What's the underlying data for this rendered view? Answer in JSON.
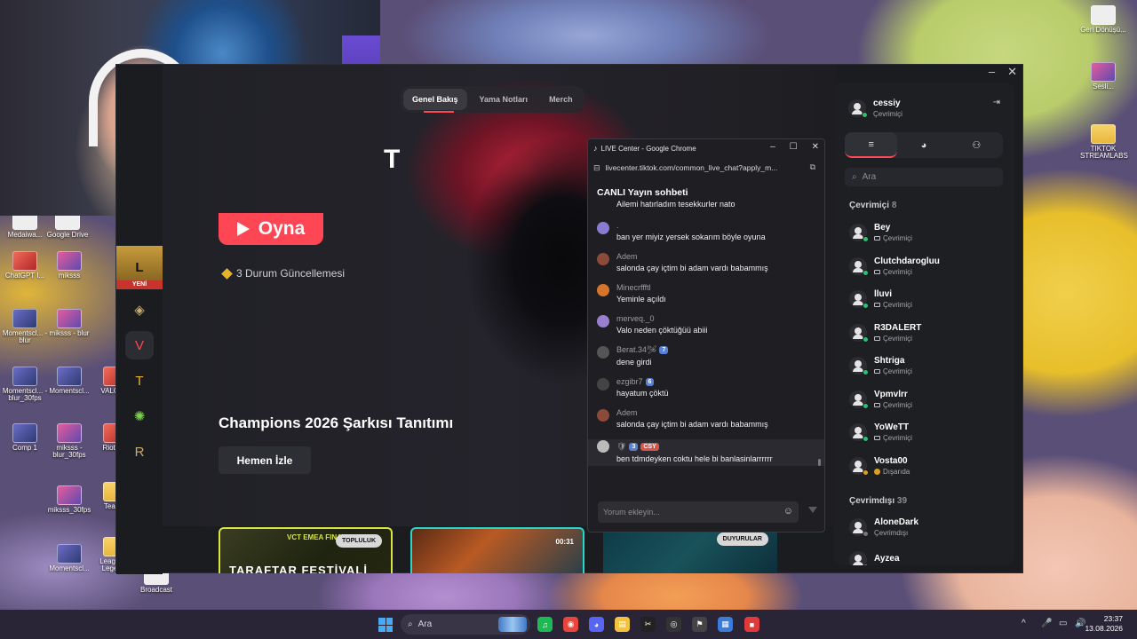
{
  "desktop": {
    "left_icons": [
      {
        "label": "Medaiwa...",
        "kind": "doc"
      },
      {
        "label": "Google Drive",
        "kind": "doc"
      },
      {
        "label": "ChatGPT I...",
        "kind": "red"
      },
      {
        "label": "miksss",
        "kind": "bright"
      },
      {
        "label": "Momentscl... - blur",
        "kind": "video"
      },
      {
        "label": "miksss - blur",
        "kind": "bright"
      },
      {
        "label": "Momentscl... - blur_30fps",
        "kind": "video"
      },
      {
        "label": "Momentscl...",
        "kind": "video"
      },
      {
        "label": "Comp 1",
        "kind": "video"
      },
      {
        "label": "miksss - blur_30fps",
        "kind": "bright"
      },
      {
        "label": "miksss_30fps",
        "kind": "bright"
      },
      {
        "label": "Momentscl...",
        "kind": "video"
      },
      {
        "label": "VALOR...",
        "kind": "red"
      },
      {
        "label": "Riot C...",
        "kind": "red"
      },
      {
        "label": "Team...",
        "kind": "folder"
      },
      {
        "label": "League of Legends",
        "kind": "folder"
      },
      {
        "label": "Broadcast",
        "kind": "doc"
      }
    ],
    "right_icons": [
      {
        "label": "Geri Dönüşü...",
        "kind": "doc"
      },
      {
        "label": "Sesli...",
        "kind": "bright"
      },
      {
        "label": "TIKTOK STREAMLABS",
        "kind": "folder"
      }
    ]
  },
  "riot_client": {
    "window_controls": {
      "minimize": "–",
      "close": "✕"
    },
    "nav_tabs": [
      {
        "label": "Genel Bakış",
        "active": true
      },
      {
        "label": "Yama Notları",
        "active": false
      },
      {
        "label": "Merch",
        "active": false
      }
    ],
    "logo_letter": "T",
    "sidebar": {
      "new_label": "YENİ",
      "items": [
        {
          "name": "league-of-legends",
          "glyph": "L"
        },
        {
          "name": "legends-of-runeterra",
          "glyph": "◈"
        },
        {
          "name": "valorant",
          "glyph": "V"
        },
        {
          "name": "teamfight-tactics",
          "glyph": "T"
        },
        {
          "name": "wild-rift",
          "glyph": "✺"
        },
        {
          "name": "runeterra-2xko",
          "glyph": "R"
        }
      ]
    },
    "play_label": "Oyna",
    "status_updates": "3 Durum Güncellemesi",
    "promo_title": "Champions 2026 Şarkısı Tanıtımı",
    "watch_label": "Hemen İzle",
    "cards": [
      {
        "tag": "TOPLULUK",
        "title": "TARAFTAR FESTİVALİ",
        "logo": "VCT EMEA FINALS",
        "duration": ""
      },
      {
        "tag": "",
        "title": "",
        "logo": "",
        "duration": "00:31"
      },
      {
        "tag": "DUYURULAR",
        "title": "",
        "logo": "",
        "duration": ""
      }
    ]
  },
  "friends": {
    "self": {
      "name": "cessiy",
      "status": "Çevrimiçi"
    },
    "collapse_icon": "⇥",
    "tabs": [
      "≡",
      "◕",
      "⚇"
    ],
    "search_placeholder": "Ara",
    "online_label": "Çevrimiçi",
    "online_count": "8",
    "online": [
      {
        "name": "Bey",
        "status": "Çevrimiçi",
        "state": "online"
      },
      {
        "name": "Clutchdarogluu",
        "status": "Çevrimiçi",
        "state": "online"
      },
      {
        "name": "lluvi",
        "status": "Çevrimiçi",
        "state": "online"
      },
      {
        "name": "R3DALERT",
        "status": "Çevrimiçi",
        "state": "online"
      },
      {
        "name": "Shtriga",
        "status": "Çevrimiçi",
        "state": "online"
      },
      {
        "name": "Vpmvlrr",
        "status": "Çevrimiçi",
        "state": "online"
      },
      {
        "name": "YoWeTT",
        "status": "Çevrimiçi",
        "state": "online"
      },
      {
        "name": "Vosta00",
        "status": "Dışarıda",
        "state": "away"
      }
    ],
    "offline_label": "Çevrimdışı",
    "offline_count": "39",
    "offline": [
      {
        "name": "AloneDark",
        "status": "Çevrimdışı",
        "state": "off"
      },
      {
        "name": "Ayzea",
        "status": "",
        "state": "off"
      }
    ]
  },
  "chat_window": {
    "title": "LIVE Center - Google Chrome",
    "controls": {
      "minimize": "–",
      "maximize": "☐",
      "close": "✕"
    },
    "url": "livecenter.tiktok.com/common_live_chat?apply_m...",
    "heading": "CANLI Yayın sohbeti",
    "messages": [
      {
        "user": "",
        "text": "Ailemi hatırladım tesekkurler nato",
        "avatar_color": "",
        "level": "",
        "fan": "",
        "highlight": false
      },
      {
        "user": ".",
        "text": "ban yer miyiz yersek sokarım böyle oyuna",
        "avatar_color": "#8a7bd1",
        "level": "",
        "fan": "",
        "highlight": false
      },
      {
        "user": "Adem",
        "text": "salonda çay içtim bi adam vardı babammış",
        "avatar_color": "#8c4a3a",
        "level": "",
        "fan": "",
        "highlight": false
      },
      {
        "user": "Minecrffftl",
        "text": "Yeminle açıldı",
        "avatar_color": "#d6742c",
        "level": "",
        "fan": "",
        "highlight": false
      },
      {
        "user": "merveq._0",
        "text": "Valo neden çöktüğüü abiii",
        "avatar_color": "#9a7fd1",
        "level": "",
        "fan": "",
        "highlight": false
      },
      {
        "user": "Berat.34🛩",
        "text": "dene girdi",
        "avatar_color": "#555",
        "level": "7",
        "fan": "",
        "highlight": false
      },
      {
        "user": "ezgibr7",
        "text": "hayatum çöktü",
        "avatar_color": "#444",
        "level": "6",
        "fan": "",
        "highlight": false
      },
      {
        "user": "Adem",
        "text": "salonda çay içtim bi adam vardı babammış",
        "avatar_color": "#8c4a3a",
        "level": "",
        "fan": "",
        "highlight": false
      },
      {
        "user": "🛡",
        "text": "ben tdmdeyken coktu hele bi banlasinlarrrrrr",
        "avatar_color": "#bbb",
        "level": "3",
        "fan": "CSY",
        "highlight": true
      }
    ],
    "input_placeholder": "Yorum ekleyin...",
    "emoji_icon": "☺"
  },
  "taskbar": {
    "search_placeholder": "Ara",
    "apps": [
      {
        "name": "spotify",
        "glyph": "♫",
        "color": "#1db954"
      },
      {
        "name": "chrome",
        "glyph": "◉",
        "color": "#e8453c"
      },
      {
        "name": "discord",
        "glyph": "◕",
        "color": "#5865f2"
      },
      {
        "name": "file-explorer",
        "glyph": "▤",
        "color": "#f3c33d"
      },
      {
        "name": "capcut",
        "glyph": "✂",
        "color": "#222"
      },
      {
        "name": "obs",
        "glyph": "◎",
        "color": "#333"
      },
      {
        "name": "riot-client",
        "glyph": "⚑",
        "color": "#444"
      },
      {
        "name": "notepad",
        "glyph": "▦",
        "color": "#3b7bd9"
      },
      {
        "name": "streamlabs",
        "glyph": "■",
        "color": "#e03a3a"
      }
    ],
    "tray": [
      "^",
      "🎤",
      "▭",
      "🔊"
    ],
    "time": "23:37",
    "date": "13.08.2026"
  }
}
